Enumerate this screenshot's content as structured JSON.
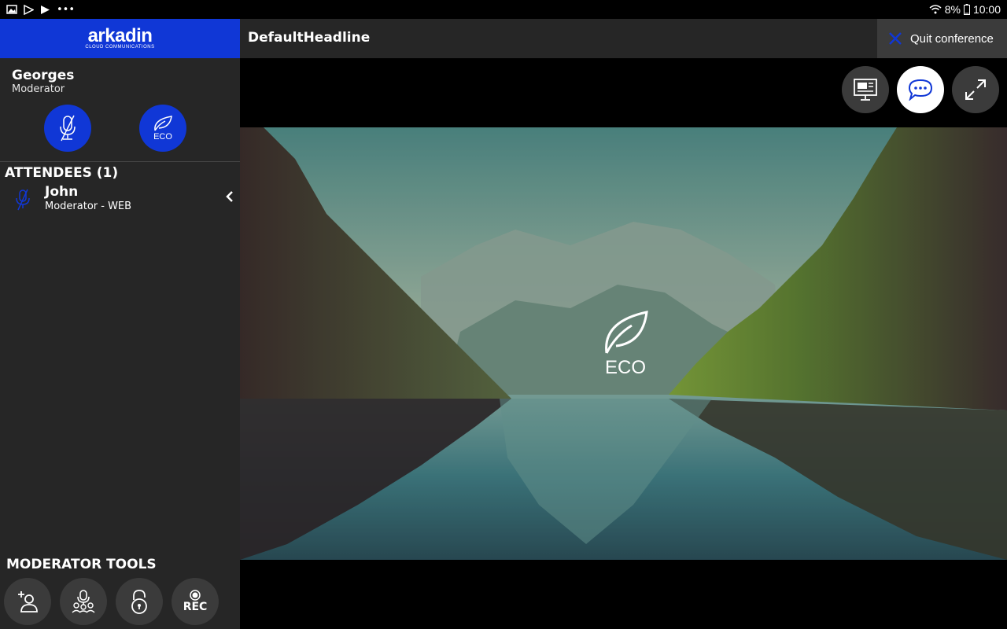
{
  "status_bar": {
    "battery": "8%",
    "time": "10:00"
  },
  "logo": {
    "word": "arkadin",
    "sub": "CLOUD COMMUNICATIONS"
  },
  "header": {
    "headline": "DefaultHeadline",
    "quit_label": "Quit conference"
  },
  "user": {
    "name": "Georges",
    "role": "Moderator",
    "eco_label": "ECO"
  },
  "attendees": {
    "title": "ATTENDEES (1)",
    "items": [
      {
        "name": "John",
        "role": "Moderator - WEB"
      }
    ]
  },
  "moderator_tools": {
    "title": "MODERATOR TOOLS",
    "rec_label": "REC"
  },
  "stage": {
    "eco_label": "ECO"
  },
  "colors": {
    "brand_blue": "#1037d6",
    "panel": "#262626",
    "button_dark": "#3b3b3b"
  }
}
